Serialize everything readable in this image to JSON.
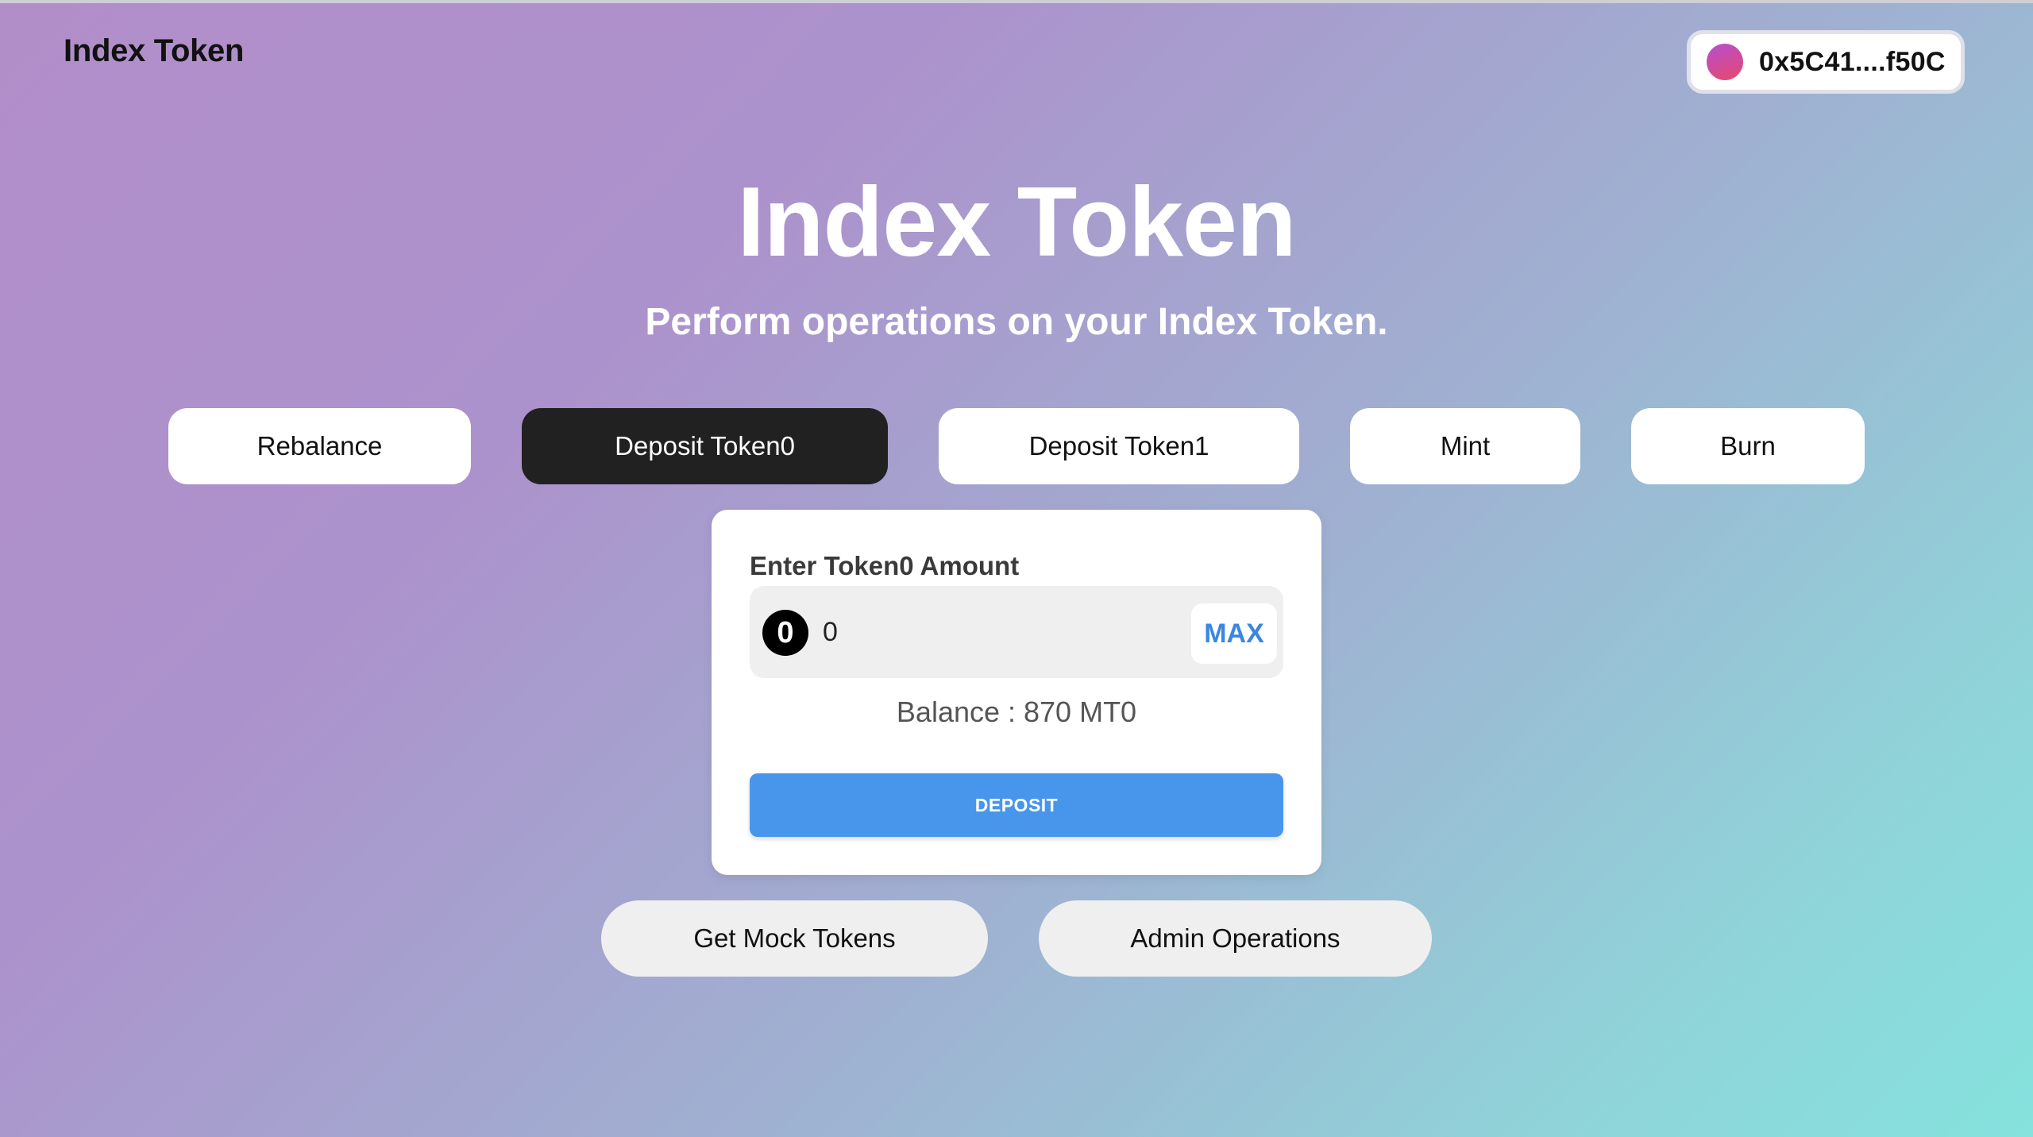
{
  "header": {
    "brand": "Index Token",
    "wallet_address": "0x5C41....f50C"
  },
  "hero": {
    "title": "Index Token",
    "subtitle": "Perform operations on your Index Token."
  },
  "tabs": [
    {
      "label": "Rebalance",
      "active": false
    },
    {
      "label": "Deposit Token0",
      "active": true
    },
    {
      "label": "Deposit Token1",
      "active": false
    },
    {
      "label": "Mint",
      "active": false
    },
    {
      "label": "Burn",
      "active": false
    }
  ],
  "deposit_card": {
    "label": "Enter Token0 Amount",
    "token_icon_glyph": "0",
    "amount_value": "0",
    "max_label": "MAX",
    "balance_text": "Balance : 870 MT0",
    "submit_label": "DEPOSIT"
  },
  "footer_buttons": {
    "mock_tokens": "Get Mock Tokens",
    "admin": "Admin Operations"
  },
  "colors": {
    "active_tab": "#212121",
    "deposit_button": "#4896ec",
    "max_text": "#3a87e0"
  }
}
